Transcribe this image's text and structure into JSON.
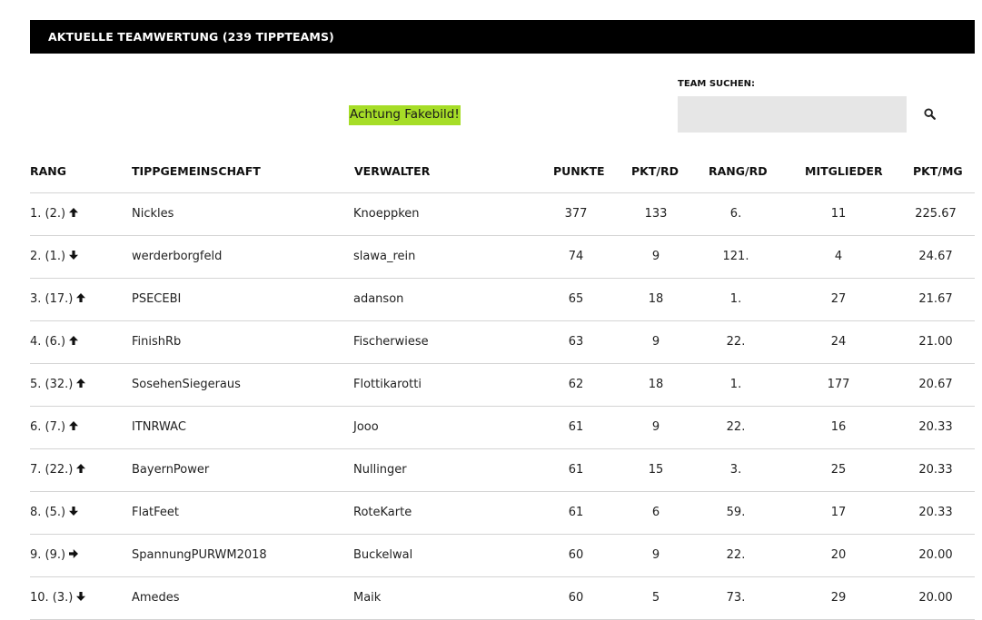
{
  "header": {
    "title": "AKTUELLE TEAMWERTUNG (239 TIPPTEAMS)"
  },
  "notice": {
    "text": "Achtung Fakebild!"
  },
  "search": {
    "label": "TEAM SUCHEN:",
    "placeholder": ""
  },
  "colors": {
    "header_bg": "#000000",
    "notice_bg": "#a6dd27",
    "search_bg": "#e6e6e6"
  },
  "table": {
    "columns": {
      "rang": "RANG",
      "team": "TIPPGEMEINSCHAFT",
      "admin": "VERWALTER",
      "points": "PUNKTE",
      "pktrd": "PKT/RD",
      "rangrd": "RANG/RD",
      "members": "MITGLIEDER",
      "pktmg": "PKT/MG"
    },
    "rows": [
      {
        "rank": "1. (2.)",
        "trend": "up",
        "team": "Nickles",
        "admin": "Knoeppken",
        "points": "377",
        "pktrd": "133",
        "rangrd": "6.",
        "members": "11",
        "pktmg": "225.67"
      },
      {
        "rank": "2. (1.)",
        "trend": "down",
        "team": "werderborgfeld",
        "admin": "slawa_rein",
        "points": "74",
        "pktrd": "9",
        "rangrd": "121.",
        "members": "4",
        "pktmg": "24.67"
      },
      {
        "rank": "3. (17.)",
        "trend": "up",
        "team": "PSECEBI",
        "admin": "adanson",
        "points": "65",
        "pktrd": "18",
        "rangrd": "1.",
        "members": "27",
        "pktmg": "21.67"
      },
      {
        "rank": "4. (6.)",
        "trend": "up",
        "team": "FinishRb",
        "admin": "Fischerwiese",
        "points": "63",
        "pktrd": "9",
        "rangrd": "22.",
        "members": "24",
        "pktmg": "21.00"
      },
      {
        "rank": "5. (32.)",
        "trend": "up",
        "team": "SosehenSiegeraus",
        "admin": "Flottikarotti",
        "points": "62",
        "pktrd": "18",
        "rangrd": "1.",
        "members": "177",
        "pktmg": "20.67"
      },
      {
        "rank": "6. (7.)",
        "trend": "up",
        "team": "ITNRWAC",
        "admin": "Jooo",
        "points": "61",
        "pktrd": "9",
        "rangrd": "22.",
        "members": "16",
        "pktmg": "20.33"
      },
      {
        "rank": "7. (22.)",
        "trend": "up",
        "team": "BayernPower",
        "admin": "Nullinger",
        "points": "61",
        "pktrd": "15",
        "rangrd": "3.",
        "members": "25",
        "pktmg": "20.33"
      },
      {
        "rank": "8. (5.)",
        "trend": "down",
        "team": "FlatFeet",
        "admin": "RoteKarte",
        "points": "61",
        "pktrd": "6",
        "rangrd": "59.",
        "members": "17",
        "pktmg": "20.33"
      },
      {
        "rank": "9. (9.)",
        "trend": "right",
        "team": "SpannungPURWM2018",
        "admin": "Buckelwal",
        "points": "60",
        "pktrd": "9",
        "rangrd": "22.",
        "members": "20",
        "pktmg": "20.00"
      },
      {
        "rank": "10. (3.)",
        "trend": "down",
        "team": "Amedes",
        "admin": "Maik",
        "points": "60",
        "pktrd": "5",
        "rangrd": "73.",
        "members": "29",
        "pktmg": "20.00"
      }
    ]
  }
}
